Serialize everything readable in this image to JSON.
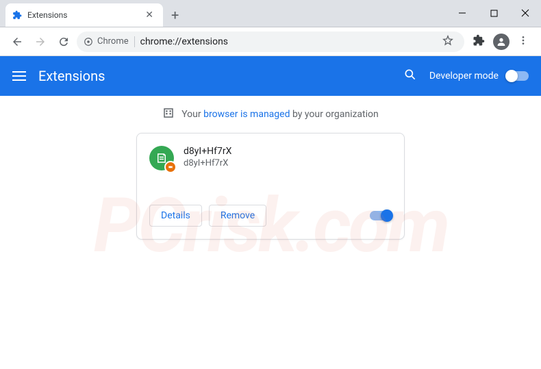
{
  "window": {
    "tab_title": "Extensions",
    "new_tab_glyph": "+"
  },
  "toolbar": {
    "chrome_chip": "Chrome",
    "url": "chrome://extensions"
  },
  "header": {
    "title": "Extensions",
    "dev_mode_label": "Developer mode"
  },
  "managed": {
    "prefix": "Your ",
    "link": "browser is managed",
    "suffix": " by your organization"
  },
  "extension": {
    "name": "d8yI+Hf7rX",
    "description": "d8yI+Hf7rX",
    "details_label": "Details",
    "remove_label": "Remove"
  },
  "watermark": "PCrisk.com"
}
